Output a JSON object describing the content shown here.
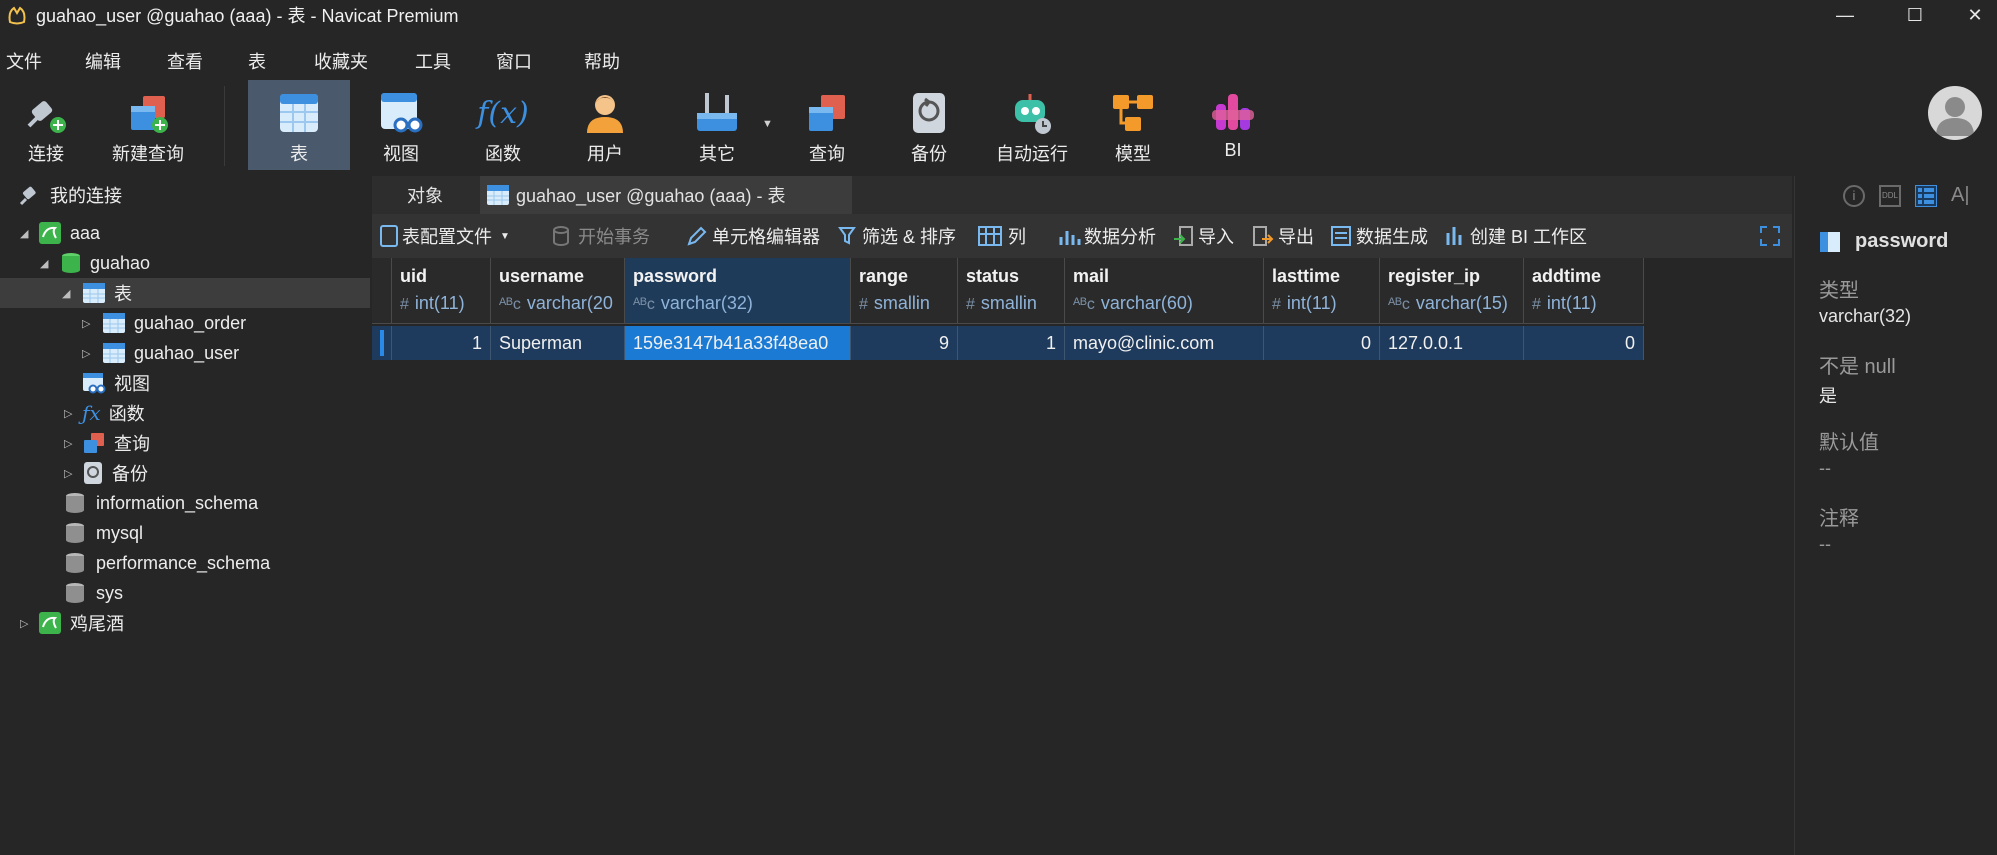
{
  "window": {
    "title": "guahao_user @guahao (aaa) - 表 - Navicat Premium",
    "minimize": "—",
    "maximize": "☐",
    "close": "✕"
  },
  "menu": [
    "文件",
    "编辑",
    "查看",
    "表",
    "收藏夹",
    "工具",
    "窗口",
    "帮助"
  ],
  "toolbar": {
    "connect": "连接",
    "new_query": "新建查询",
    "table": "表",
    "view": "视图",
    "function": "函数",
    "user": "用户",
    "other": "其它",
    "query": "查询",
    "backup": "备份",
    "automation": "自动运行",
    "model": "模型",
    "bi": "BI",
    "function_glyph": "f(x)"
  },
  "sidebar": {
    "header": "我的连接",
    "conn_aaa": "aaa",
    "db_guahao": "guahao",
    "tables": "表",
    "table_order": "guahao_order",
    "table_user": "guahao_user",
    "views": "视图",
    "functions": "函数",
    "queries": "查询",
    "backups": "备份",
    "db_information_schema": "information_schema",
    "db_mysql": "mysql",
    "db_performance_schema": "performance_schema",
    "db_sys": "sys",
    "conn_cocktail": "鸡尾酒"
  },
  "tabs": {
    "objects": "对象",
    "active": "guahao_user @guahao (aaa) - 表"
  },
  "subtoolbar": {
    "profile": "表配置文件",
    "begin_tx": "开始事务",
    "cell_editor": "单元格编辑器",
    "filter_sort": "筛选 & 排序",
    "columns": "列",
    "analysis": "数据分析",
    "import": "导入",
    "export": "导出",
    "generate": "数据生成",
    "create_bi": "创建 BI 工作区"
  },
  "grid": {
    "columns": [
      {
        "name": "uid",
        "type": "int(11)"
      },
      {
        "name": "username",
        "type": "varchar(20"
      },
      {
        "name": "password",
        "type": "varchar(32)"
      },
      {
        "name": "range",
        "type": "smallin"
      },
      {
        "name": "status",
        "type": "smallin"
      },
      {
        "name": "mail",
        "type": "varchar(60)"
      },
      {
        "name": "lasttime",
        "type": "int(11)"
      },
      {
        "name": "register_ip",
        "type": "varchar(15)"
      },
      {
        "name": "addtime",
        "type": "int(11)"
      }
    ],
    "row": {
      "uid": "1",
      "username": "Superman",
      "password": "159e3147b41a33f48ea0",
      "range": "9",
      "status": "1",
      "mail": "mayo@clinic.com",
      "lasttime": "0",
      "register_ip": "127.0.0.1",
      "addtime": "0"
    },
    "type_icons": {
      "num": "#",
      "text": "ᴬᴮc"
    }
  },
  "right_panel": {
    "field": "password",
    "type_label": "类型",
    "type_value": "varchar(32)",
    "notnull_label": "不是 null",
    "notnull_value": "是",
    "default_label": "默认值",
    "default_value": "--",
    "comment_label": "注释",
    "comment_value": "--"
  },
  "colors": {
    "accent": "#1a7ad4",
    "row_bg": "#1e3a5c",
    "toolbar_active": "#4a5a6c"
  }
}
